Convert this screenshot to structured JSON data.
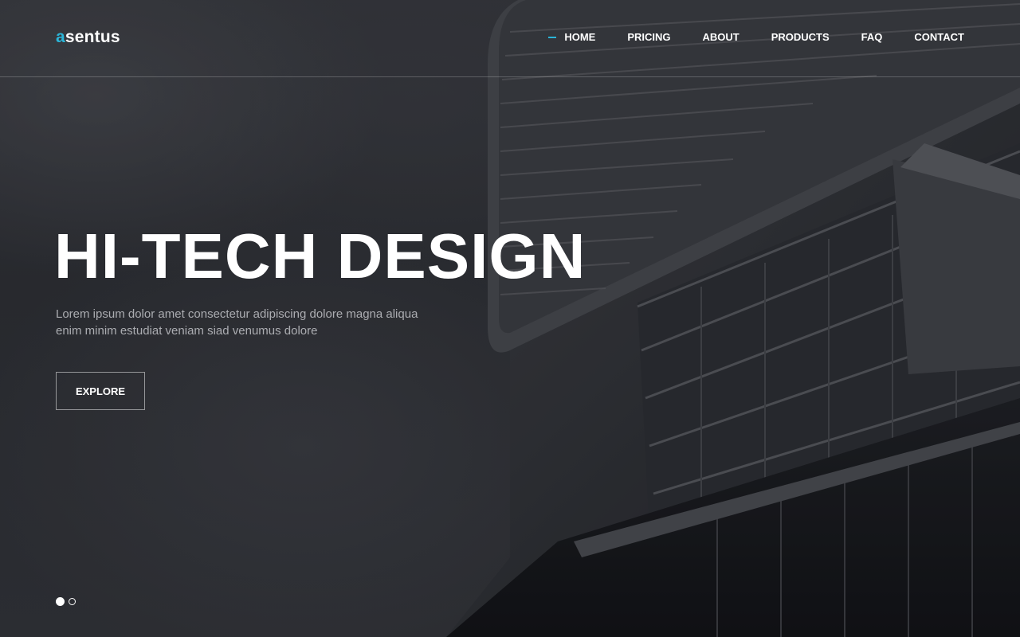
{
  "brand": {
    "logo_accent": "a",
    "logo_rest": "sentus",
    "accent_color": "#2bb5d8"
  },
  "nav": {
    "items": [
      {
        "label": "HOME",
        "active": true
      },
      {
        "label": "PRICING",
        "active": false
      },
      {
        "label": "ABOUT",
        "active": false
      },
      {
        "label": "PRODUCTS",
        "active": false
      },
      {
        "label": "FAQ",
        "active": false
      },
      {
        "label": "CONTACT",
        "active": false
      }
    ]
  },
  "hero": {
    "headline": "HI-TECH DESIGN",
    "subtext_line1": "Lorem ipsum dolor amet consectetur adipiscing dolore magna aliqua",
    "subtext_line2": "enim minim estudiat veniam siad venumus dolore",
    "cta_label": "EXPLORE"
  },
  "slider": {
    "slide_count": 2,
    "active_slide": 1
  }
}
